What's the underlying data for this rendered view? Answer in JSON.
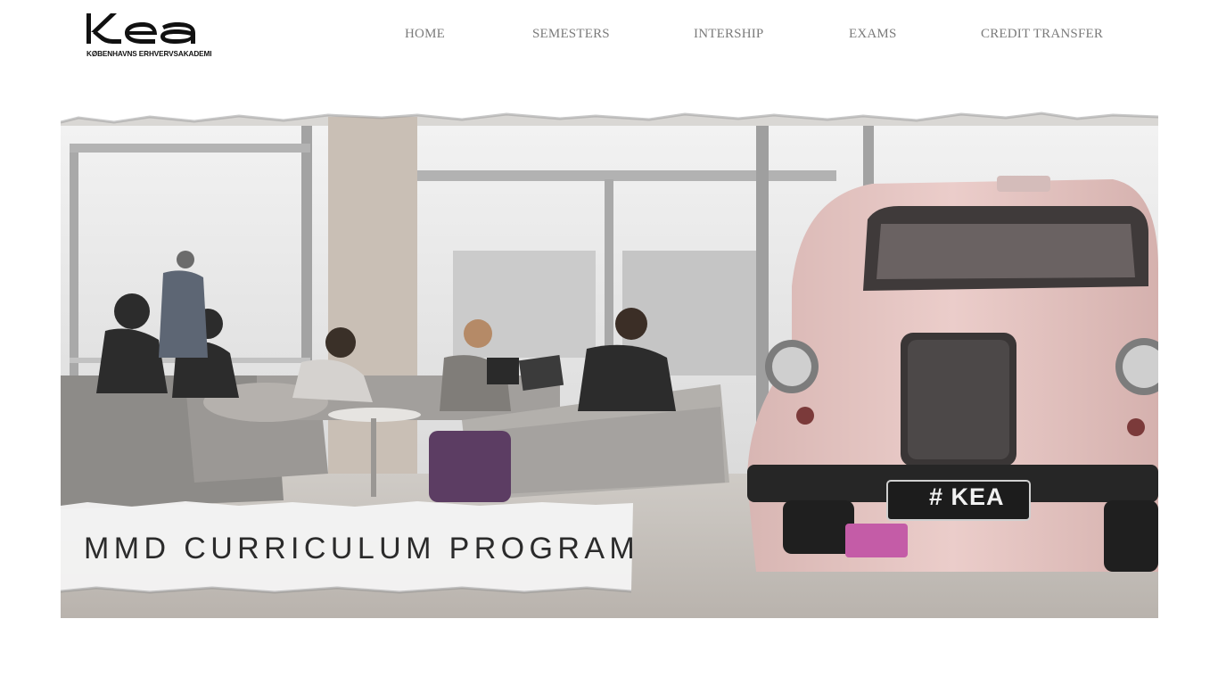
{
  "brand": {
    "logo_text": "KEA",
    "logo_subtitle": "KØBENHAVNS ERHVERVSAKADEMI"
  },
  "nav": {
    "items": [
      {
        "label": "HOME"
      },
      {
        "label": "SEMESTERS"
      },
      {
        "label": "INTERSHIP"
      },
      {
        "label": "EXAMS"
      },
      {
        "label": "CREDIT TRANSFER"
      }
    ]
  },
  "hero": {
    "banner_title": "MMD CURRICULUM PROGRAM",
    "plate_text": "# KEA",
    "image_description_icon": "hero-photo",
    "accent_pink": "#e2c3c0"
  }
}
